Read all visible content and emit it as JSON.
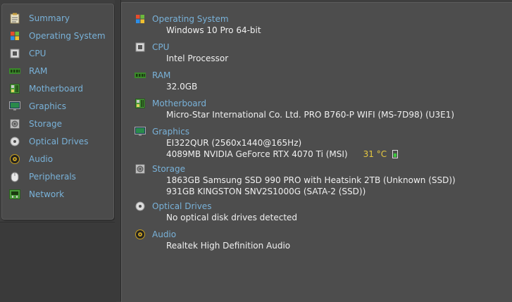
{
  "sidebar": {
    "items": [
      {
        "label": "Summary",
        "icon": "clipboard-icon"
      },
      {
        "label": "Operating System",
        "icon": "windows-logo-icon"
      },
      {
        "label": "CPU",
        "icon": "cpu-chip-icon"
      },
      {
        "label": "RAM",
        "icon": "ram-stick-icon"
      },
      {
        "label": "Motherboard",
        "icon": "motherboard-icon"
      },
      {
        "label": "Graphics",
        "icon": "monitor-icon"
      },
      {
        "label": "Storage",
        "icon": "hard-drive-icon"
      },
      {
        "label": "Optical Drives",
        "icon": "optical-disc-icon"
      },
      {
        "label": "Audio",
        "icon": "speaker-icon"
      },
      {
        "label": "Peripherals",
        "icon": "mouse-icon"
      },
      {
        "label": "Network",
        "icon": "network-icon"
      }
    ]
  },
  "summary": {
    "os": {
      "title": "Operating System",
      "lines": [
        "Windows 10 Pro 64-bit"
      ]
    },
    "cpu": {
      "title": "CPU",
      "lines": [
        "Intel Processor"
      ]
    },
    "ram": {
      "title": "RAM",
      "lines": [
        "32.0GB"
      ]
    },
    "motherboard": {
      "title": "Motherboard",
      "lines": [
        "Micro-Star International Co. Ltd. PRO B760-P WIFI (MS-7D98) (U3E1)"
      ]
    },
    "graphics": {
      "title": "Graphics",
      "lines": [
        "EI322QUR (2560x1440@165Hz)",
        "4089MB NVIDIA GeForce RTX 4070 Ti (MSI)"
      ],
      "temperature": "31 °C"
    },
    "storage": {
      "title": "Storage",
      "lines": [
        "1863GB Samsung SSD 990 PRO with Heatsink 2TB (Unknown (SSD))",
        "931GB KINGSTON SNV2S1000G (SATA-2 (SSD))"
      ]
    },
    "optical": {
      "title": "Optical Drives",
      "lines": [
        "No optical disk drives detected"
      ]
    },
    "audio": {
      "title": "Audio",
      "lines": [
        "Realtek High Definition Audio"
      ]
    }
  },
  "colors": {
    "accent_text": "#79b2d9",
    "value_text": "#f0f0f0",
    "temperature_text": "#e6c840",
    "panel_bg": "#4d4d4d"
  }
}
